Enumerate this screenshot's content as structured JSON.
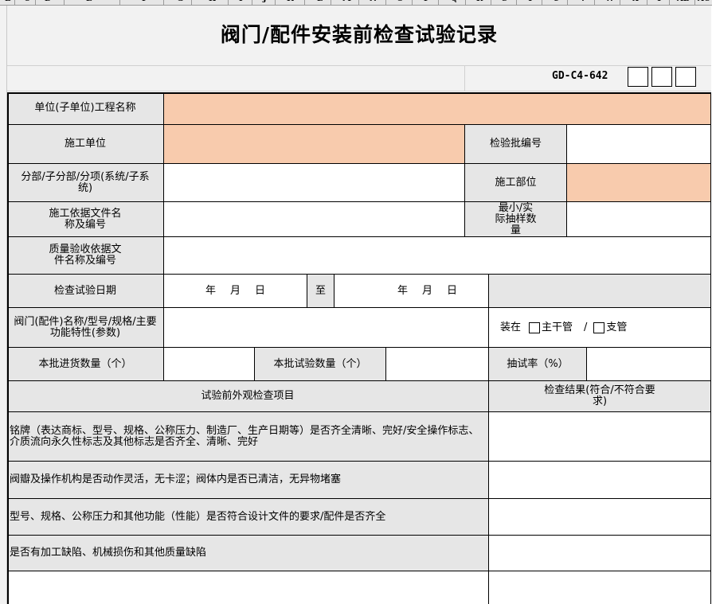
{
  "title": "阀门/配件安装前检查试验记录",
  "form_code": "GD-C4-642",
  "labels": {
    "unit_project_name": "单位(子单位)工程名称",
    "construction_unit": "施工单位",
    "inspection_batch_no": "检验批编号",
    "division": "分部/子分部/分项(系统/子系统)",
    "construction_part": "施工部位",
    "construction_basis": "施工依据文件名称及编号",
    "min_actual_sample": "最小/实际抽样数量",
    "quality_basis": "质量验收依据文件名称及编号",
    "test_date": "检查试验日期",
    "date_year": "年",
    "date_month": "月",
    "date_day": "日",
    "date_to": "至",
    "valve_name_spec": "阀门(配件)名称/型号/规格/主要功能特性(参数)",
    "install_at": "装在",
    "main_pipe": "主干管",
    "slash": "/",
    "branch_pipe": "支管",
    "batch_incoming_qty": "本批进货数量（个）",
    "batch_test_qty": "本批试验数量（个）",
    "sampling_rate": "抽试率（%）",
    "appearance_items": "试验前外观检查项目",
    "inspection_result": "检查结果(符合/不符合要求)"
  },
  "check_items": [
    "铭牌（表达商标、型号、规格、公称压力、制造厂、生产日期等）是否齐全清晰、完好/安全操作标志、介质流向永久性标志及其他标志是否齐全、清晰、完好",
    "阀瓣及操作机构是否动作灵活，无卡涩；阀体内是否已清洁，无异物堵塞",
    "型号、规格、公称压力和其他功能（性能）是否符合设计文件的要求/配件是否齐全",
    "是否有加工缺陷、机械损伤和其他质量缺陷",
    ""
  ],
  "colors": {
    "label_fill": "#e6e6e6",
    "highlight_fill": "#f8cbad",
    "border": "#000000"
  }
}
